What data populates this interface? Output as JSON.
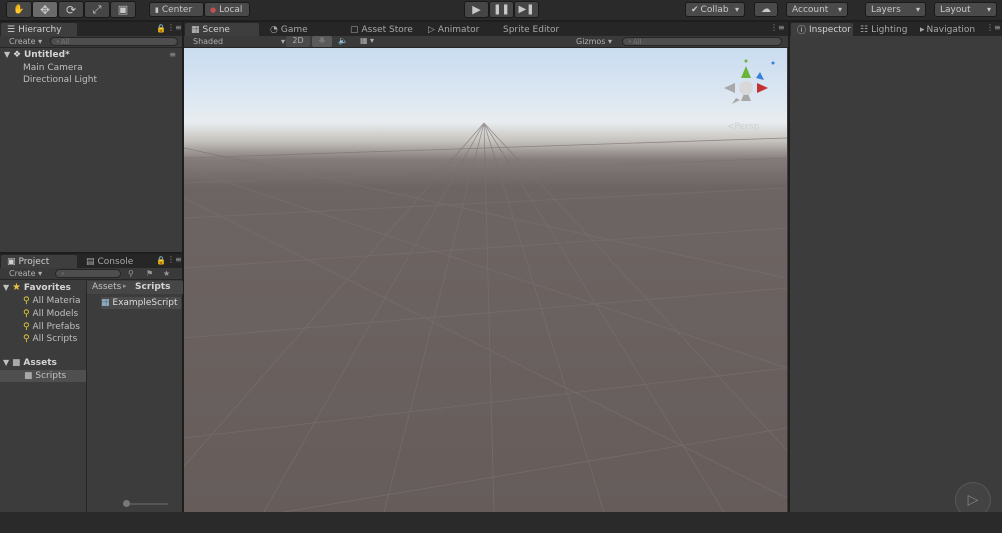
{
  "toolbar": {
    "center_label": "Center",
    "local_label": "Local",
    "collab_label": "Collab",
    "account_label": "Account",
    "layers_label": "Layers",
    "layout_label": "Layout"
  },
  "hierarchy": {
    "tab_label": "Hierarchy",
    "create_label": "Create",
    "search_placeholder": "All",
    "scene_name": "Untitled*",
    "items": [
      {
        "label": "Main Camera"
      },
      {
        "label": "Directional Light"
      }
    ]
  },
  "scene_tabs": [
    {
      "label": "Scene",
      "active": true
    },
    {
      "label": "Game",
      "active": false
    },
    {
      "label": "Asset Store",
      "active": false
    },
    {
      "label": "Animator",
      "active": false
    },
    {
      "label": "Sprite Editor",
      "active": false
    }
  ],
  "scene_toolbar": {
    "shading_mode": "Shaded",
    "mode_2d": "2D",
    "gizmos_label": "Gizmos",
    "search_placeholder": "All"
  },
  "scene": {
    "persp_label": "Persp"
  },
  "inspector_tabs": [
    {
      "label": "Inspector",
      "active": true
    },
    {
      "label": "Lighting",
      "active": false
    },
    {
      "label": "Navigation",
      "active": false
    }
  ],
  "project": {
    "tabs": [
      {
        "label": "Project",
        "active": true
      },
      {
        "label": "Console",
        "active": false
      }
    ],
    "create_label": "Create",
    "favorites_label": "Favorites",
    "favorites": [
      {
        "label": "All Materia"
      },
      {
        "label": "All Models"
      },
      {
        "label": "All Prefabs"
      },
      {
        "label": "All Scripts"
      }
    ],
    "assets_label": "Assets",
    "asset_folders": [
      {
        "label": "Scripts"
      }
    ],
    "breadcrumb": [
      "Assets",
      "Scripts"
    ],
    "files": [
      {
        "label": "ExampleScript"
      }
    ]
  },
  "colors": {
    "editor_bg": "#3c3c3c",
    "toolbar_bg": "#2a2a2a",
    "x_axis": "#c23030",
    "y_axis": "#6cb33a",
    "z_axis": "#3a7fd8",
    "favorite_star": "#e8c23a",
    "search_icon": "#e8d13a"
  }
}
